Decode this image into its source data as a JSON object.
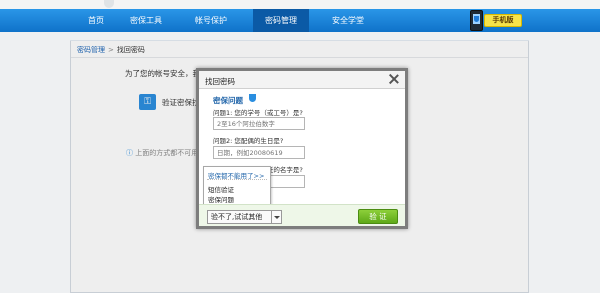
{
  "nav": {
    "items": [
      "首页",
      "密保工具",
      "帐号保护",
      "密码管理",
      "安全学堂"
    ],
    "active_index": 3
  },
  "promo": {
    "label": "手机版"
  },
  "breadcrumb": {
    "parent": "密码管理",
    "separator": ">",
    "current": "找回密码"
  },
  "page": {
    "intro": "为了您的帐号安全，我们将通过以下方式帮您 843336***  的密码：",
    "method_label": "验证密保找",
    "hint": "上面的方式都不可用"
  },
  "dialog": {
    "title": "找回密码",
    "section_title": "密保问题",
    "q1_label": "问题1: 您的学号（或工号）是?",
    "q1_placeholder": "2至16个阿拉伯数字",
    "q2_label": "问题2: 您配偶的生日是?",
    "q2_placeholder": "日期，例如20080619",
    "q3_label": "问题3: 您高中班主任的名字是?",
    "q3_placeholder": "2至6个中文",
    "dropdown": {
      "header": "密保都不能用了>>",
      "items": [
        "短信验证",
        "密保问题"
      ]
    },
    "alt_button": "验不了,试试其他",
    "verify_button": "验 证"
  },
  "colors": {
    "nav": "#1a84da",
    "accent": "#2266aa",
    "verify": "#6bb522"
  }
}
